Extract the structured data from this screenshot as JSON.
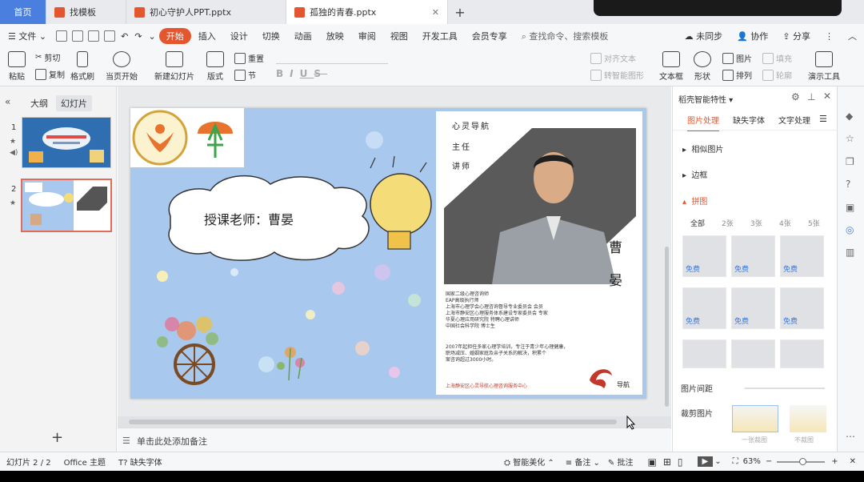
{
  "tabs": {
    "home": "首页",
    "t2": "找模板",
    "t3": "初心守护人PPT.pptx",
    "t4": "孤独的青春.pptx"
  },
  "menu": {
    "file": "文件",
    "items": [
      "开始",
      "插入",
      "设计",
      "切换",
      "动画",
      "放映",
      "审阅",
      "视图",
      "开发工具",
      "会员专享"
    ],
    "search": "查找命令、搜索模板",
    "sync": "未同步",
    "collab": "协作",
    "share": "分享"
  },
  "ribbon": {
    "paste": "粘贴",
    "cut": "剪切",
    "copy": "复制",
    "format_painter": "格式刷",
    "play_from": "当页开始",
    "new_slide": "新建幻灯片",
    "layout": "版式",
    "section": "节",
    "reset": "重置",
    "bold": "B",
    "italic": "I",
    "underline": "U",
    "strike": "S",
    "align_text": "对齐文本",
    "smartart": "转智能图形",
    "textbox": "文本框",
    "shape": "形状",
    "picture": "图片",
    "fill": "填充",
    "arrange": "排列",
    "outline": "轮廓",
    "presentation_tools": "演示工具"
  },
  "leftpanel": {
    "outline": "大纲",
    "slides": "幻灯片",
    "slide_nums": [
      "1",
      "2"
    ]
  },
  "slide": {
    "teacher": "授课老师：曹晏",
    "labels": [
      "心灵导航",
      "主任",
      "讲师"
    ],
    "name_chars": [
      "曹",
      "晏"
    ],
    "bio": [
      "国家二级心理咨询师",
      "EAP高级执行师",
      "上海市心理学会心理咨询督导专业委员会 会员",
      "上海市静安区心理服务体系建设专家委员会 专家",
      "华夏心理应用研究院 特聘心理讲师",
      "中国社会科学院 博士生"
    ],
    "bio2": [
      "2007年起担任多家心理学培训，专注于青少年心理健康，",
      "职场减压、婚姻家庭及亲子关系的解决，积累个",
      "案咨询超过3000小时。"
    ],
    "footer": "上海静安区心灵导航心理咨询服务中心",
    "logo_text": "导航"
  },
  "canvas": {
    "notes": "单击此处添加备注"
  },
  "rightpanel": {
    "title": "稻壳智能特性",
    "tabs": [
      "图片处理",
      "缺失字体",
      "文字处理"
    ],
    "sections": [
      "相似图片",
      "边框",
      "拼图"
    ],
    "filters": [
      "全部",
      "2张",
      "3张",
      "4张",
      "5张"
    ],
    "free": "免费",
    "spacing": "图片间距",
    "crop": "裁剪图片",
    "crop_opts": [
      "一张裁图",
      "不裁图"
    ]
  },
  "status": {
    "slide": "幻灯片 2 / 2",
    "theme": "Office 主题",
    "missing_font": "缺失字体",
    "smart": "智能美化",
    "notes": "备注",
    "comment": "批注",
    "zoom": "63%"
  }
}
